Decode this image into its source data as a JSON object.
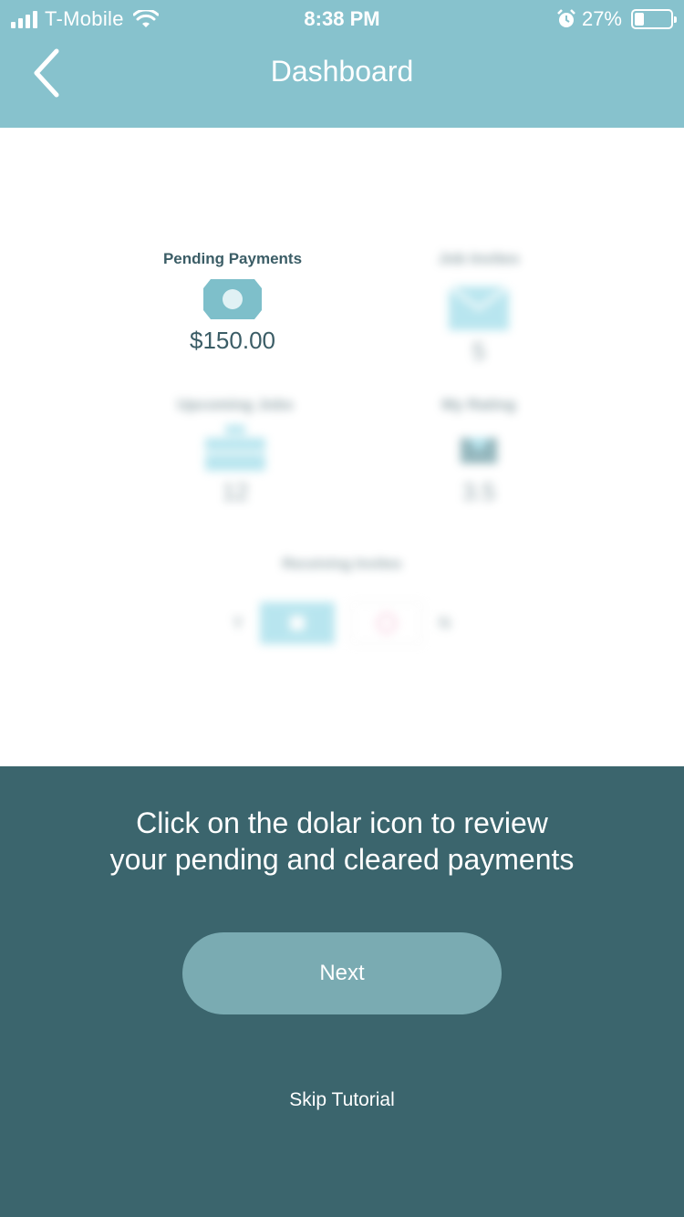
{
  "status_bar": {
    "carrier": "T-Mobile",
    "time": "8:38 PM",
    "battery_percent": "27%",
    "battery_level": 0.27
  },
  "header": {
    "title": "Dashboard",
    "back_icon": "chevron-left-icon",
    "background": "#87c2cd"
  },
  "dashboard": {
    "pending_payments": {
      "label": "Pending Payments",
      "value": "$150.00",
      "icon": "money-bill-icon"
    },
    "job_invites": {
      "label": "Job Invites",
      "value": "5",
      "icon": "mail-icon"
    },
    "upcoming_jobs": {
      "label": "Upcoming Jobs",
      "value": "12",
      "icon": "briefcase-icon"
    },
    "my_rating": {
      "label": "My Rating",
      "value": "3.5",
      "icon": "ribbon-icon"
    },
    "receiving_invites": {
      "label": "Receiving Invites",
      "yes_label": "Y",
      "no_label": "N"
    }
  },
  "tutorial": {
    "instruction": "Click on the dolar icon to review\nyour pending and cleared payments",
    "next_label": "Next",
    "skip_label": "Skip Tutorial",
    "background": "#3b656d",
    "button_color": "#7aabb2"
  }
}
